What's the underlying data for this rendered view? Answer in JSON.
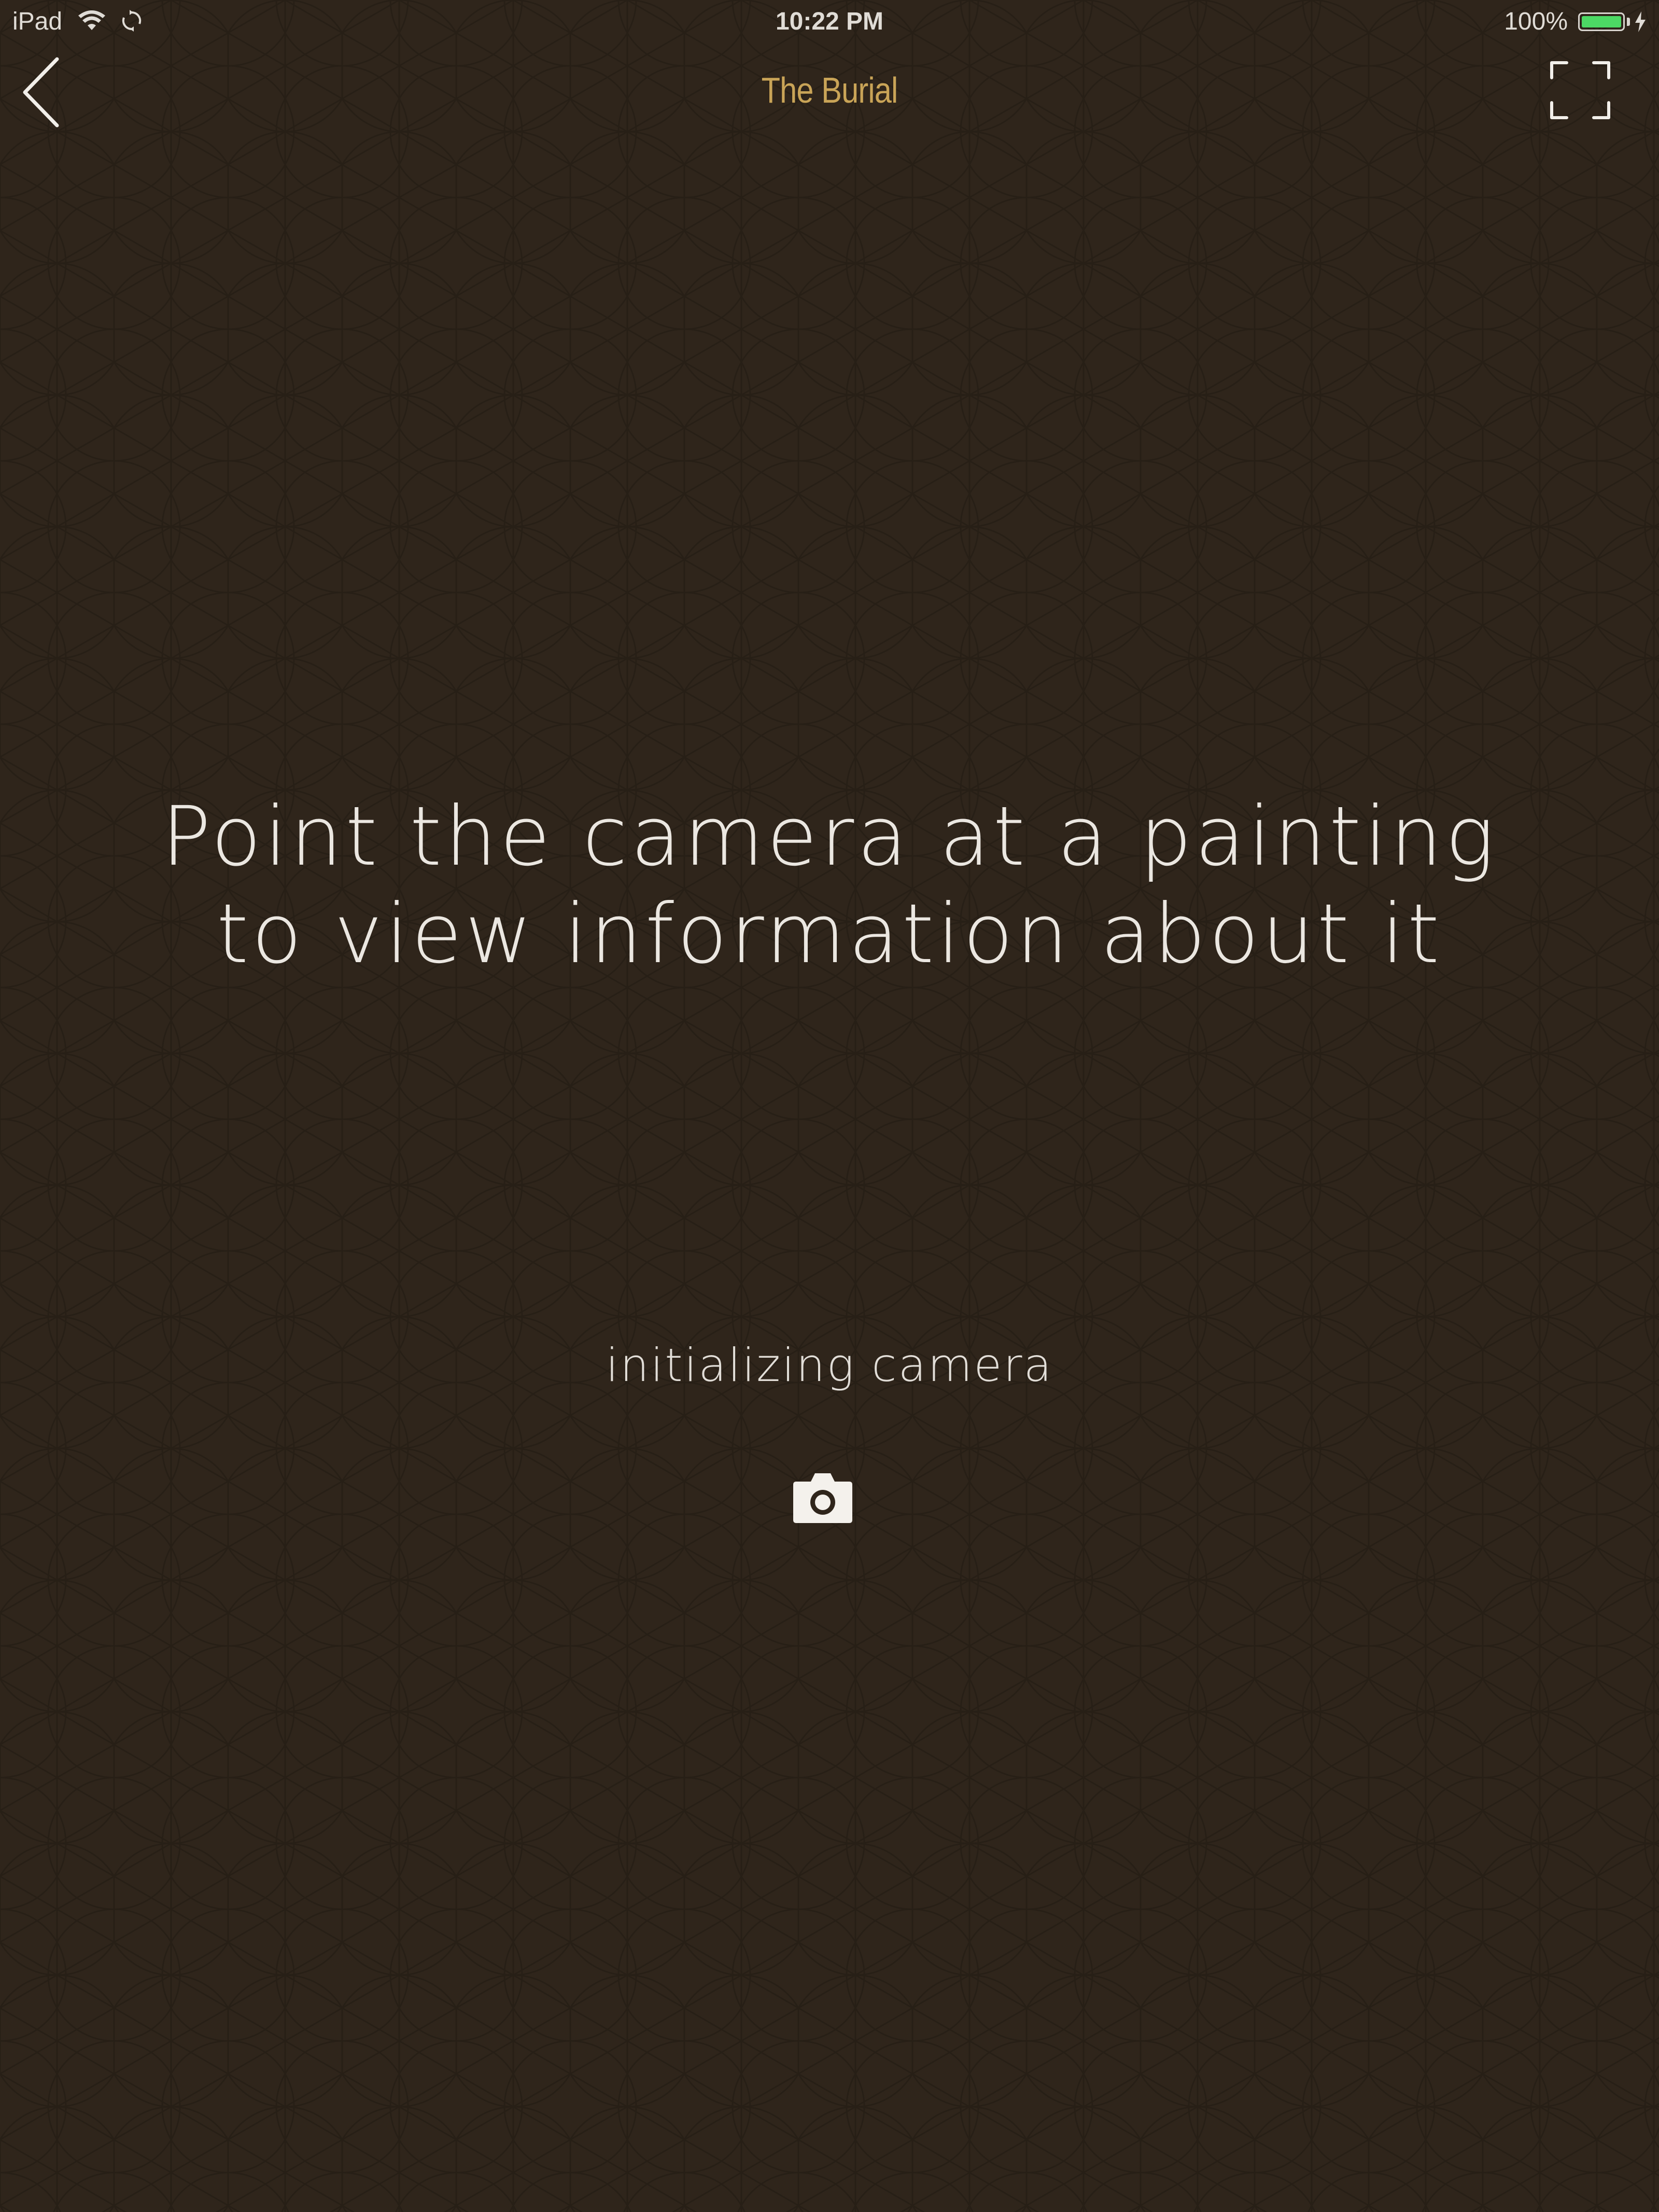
{
  "status_bar": {
    "device": "iPad",
    "time": "10:22 PM",
    "battery_percent": "100%",
    "battery_level": 1.0,
    "icons": [
      "wifi-icon",
      "sync-icon",
      "battery-icon",
      "charging-bolt-icon"
    ]
  },
  "nav": {
    "title": "The Burial",
    "back_icon": "chevron-left-icon",
    "fullscreen_icon": "fullscreen-corners-icon"
  },
  "main": {
    "instruction_line1": "Point the camera at a painting",
    "instruction_line2": "to view information about it",
    "status": "initializing camera",
    "status_icon": "camera-icon"
  },
  "colors": {
    "background": "#2f251b",
    "pattern_line": "#27201a",
    "title_accent": "#c9a457",
    "text": "#ebe7e1",
    "battery_fill": "#4cd964"
  }
}
